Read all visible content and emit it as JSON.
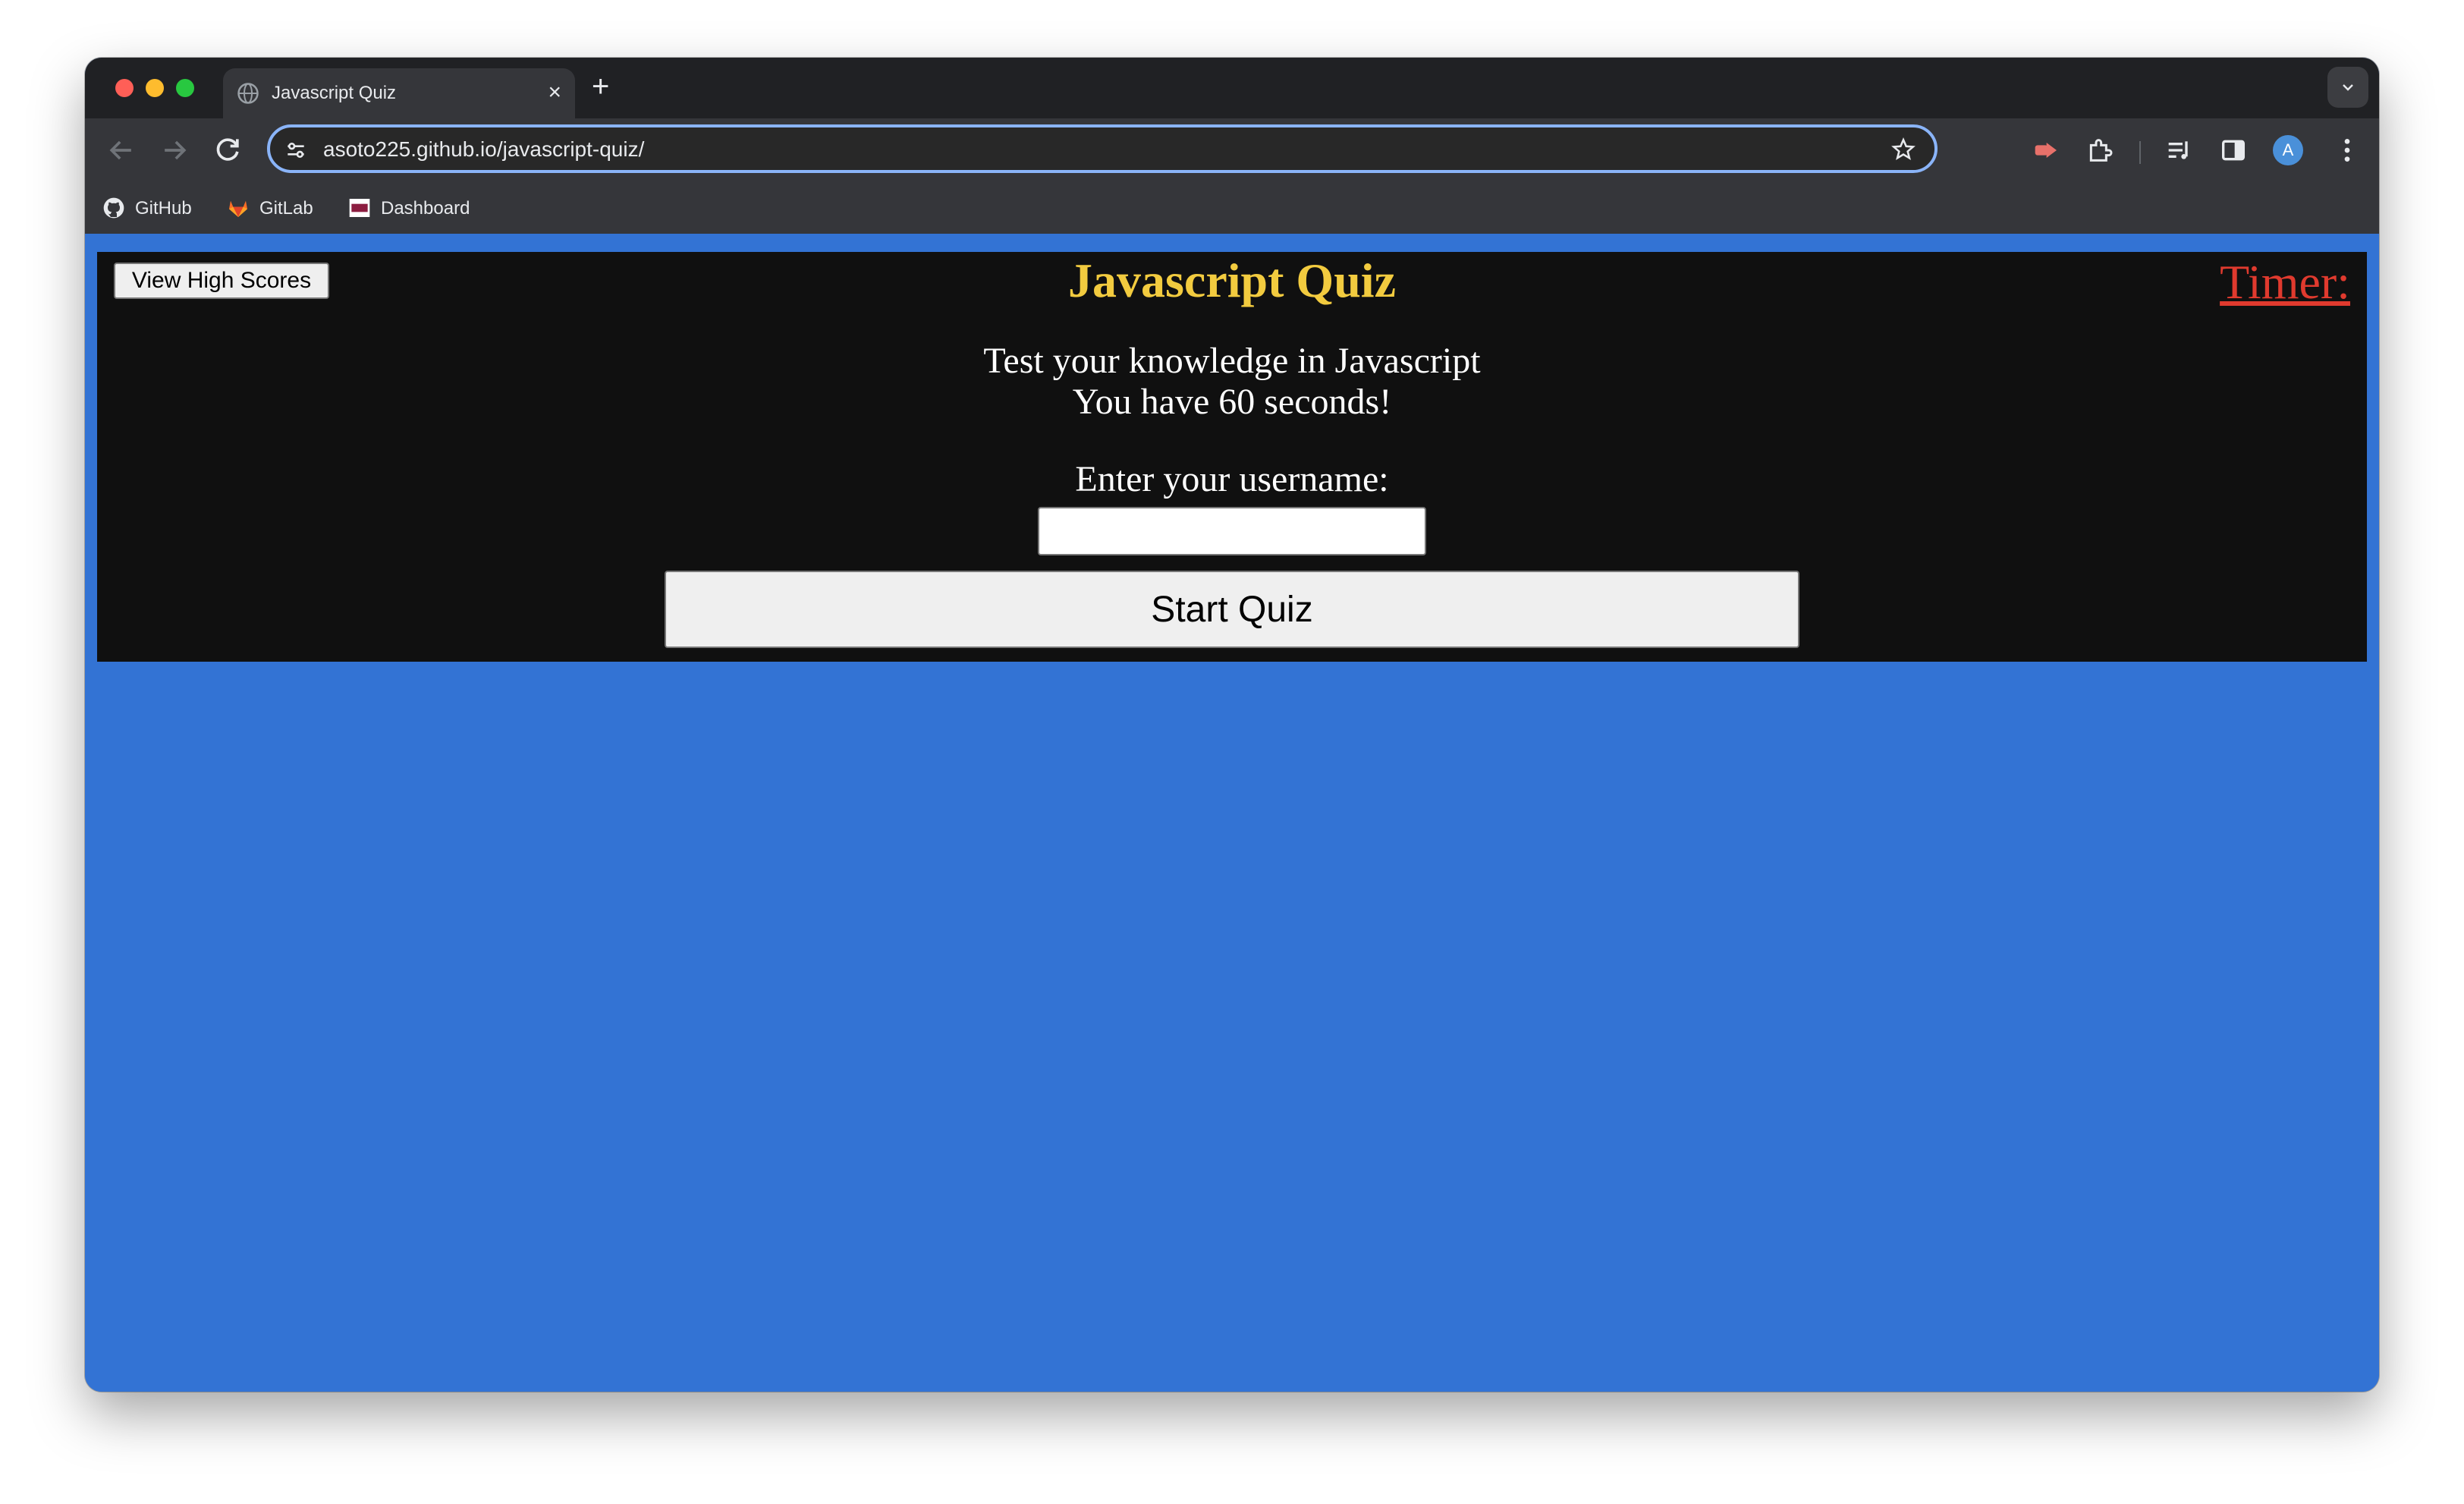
{
  "browser": {
    "tab": {
      "title": "Javascript Quiz",
      "close_glyph": "×"
    },
    "new_tab_glyph": "+",
    "url": "asoto225.github.io/javascript-quiz/",
    "profile_initial": "A",
    "bookmarks": [
      {
        "label": "GitHub",
        "icon": "github-icon"
      },
      {
        "label": "GitLab",
        "icon": "gitlab-icon"
      },
      {
        "label": "Dashboard",
        "icon": "asu-icon"
      }
    ]
  },
  "quiz": {
    "high_scores_label": "View High Scores",
    "title": "Javascript Quiz",
    "timer_label": "Timer:",
    "intro_line1": "Test your knowledge in Javascript",
    "intro_line2": "You have 60 seconds!",
    "username_prompt": "Enter your username:",
    "username_value": "",
    "start_label": "Start Quiz"
  },
  "colors": {
    "page_background": "#3373d4",
    "quiz_background": "#101010",
    "title_color": "#f2cb3f",
    "timer_color": "#e03a2e"
  }
}
